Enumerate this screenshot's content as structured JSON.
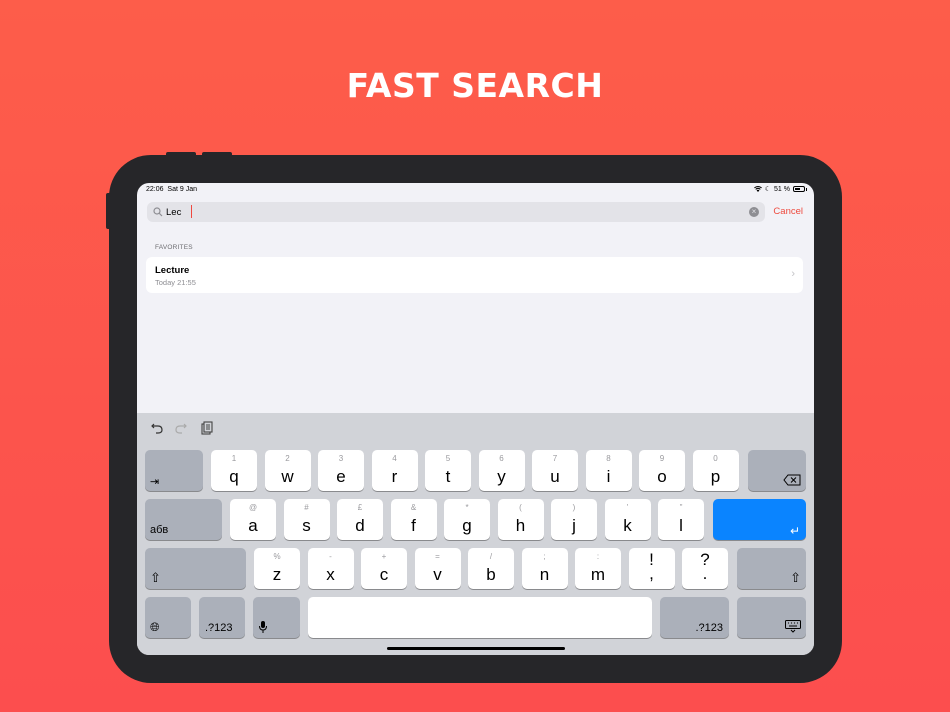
{
  "headline": "FAST SEARCH",
  "status": {
    "time": "22:06",
    "date": "Sat 9 Jan",
    "battery": "51 %"
  },
  "search": {
    "value": "Lec",
    "cancel_label": "Cancel"
  },
  "favorites": {
    "section_label": "FAVORITES",
    "items": [
      {
        "title": "Lecture",
        "subtitle": "Today 21:55"
      }
    ]
  },
  "keyboard": {
    "row1": [
      {
        "main": "q",
        "alt": "1"
      },
      {
        "main": "w",
        "alt": "2"
      },
      {
        "main": "e",
        "alt": "3"
      },
      {
        "main": "r",
        "alt": "4"
      },
      {
        "main": "t",
        "alt": "5"
      },
      {
        "main": "y",
        "alt": "6"
      },
      {
        "main": "u",
        "alt": "7"
      },
      {
        "main": "i",
        "alt": "8"
      },
      {
        "main": "o",
        "alt": "9"
      },
      {
        "main": "p",
        "alt": "0"
      }
    ],
    "row2": [
      {
        "main": "a",
        "alt": "@"
      },
      {
        "main": "s",
        "alt": "#"
      },
      {
        "main": "d",
        "alt": "£"
      },
      {
        "main": "f",
        "alt": "&"
      },
      {
        "main": "g",
        "alt": "*"
      },
      {
        "main": "h",
        "alt": "("
      },
      {
        "main": "j",
        "alt": ")"
      },
      {
        "main": "k",
        "alt": "'"
      },
      {
        "main": "l",
        "alt": "\""
      }
    ],
    "row3": [
      {
        "main": "z",
        "alt": "%"
      },
      {
        "main": "x",
        "alt": "-"
      },
      {
        "main": "c",
        "alt": "+"
      },
      {
        "main": "v",
        "alt": "="
      },
      {
        "main": "b",
        "alt": "/"
      },
      {
        "main": "n",
        "alt": ";"
      },
      {
        "main": "m",
        "alt": ":"
      },
      {
        "main": "!",
        "alt": ""
      },
      {
        "main": "?",
        "alt": ""
      }
    ],
    "row3_bottom": {
      "!": ",",
      "?": "."
    },
    "lang_label": "абв",
    "numbers_label": ".?123",
    "colors": {
      "key": "#ffffff",
      "dark_key": "#abb0ba",
      "return": "#0a84ff"
    }
  },
  "colors": {
    "accent": "#ee4b3f",
    "bg_top": "#fd5d4a",
    "bg_bottom": "#fc4e4e"
  }
}
